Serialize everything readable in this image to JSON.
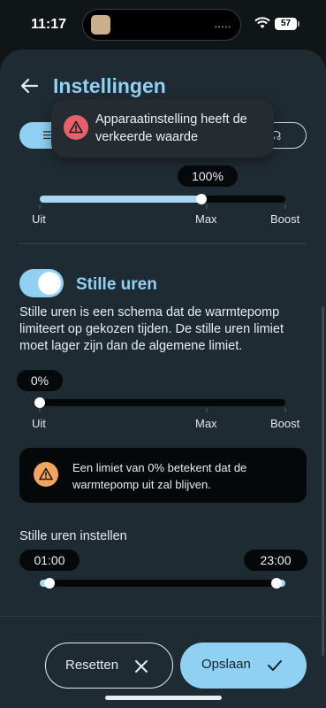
{
  "status_bar": {
    "time": "11:17",
    "battery": "57",
    "island_dots": "•••••"
  },
  "header": {
    "title": "Instellingen"
  },
  "segmented": {
    "left_glyph": "☰",
    "right_glyph": "☊"
  },
  "toast": {
    "message": "Apparaatinstelling heeft de verkeerde waarde"
  },
  "limit_slider": {
    "value_label": "100%",
    "value_fraction": 0.66,
    "labels": {
      "min": "Uit",
      "mid": "Max",
      "max": "Boost"
    }
  },
  "quiet_hours": {
    "enabled": true,
    "title": "Stille uren",
    "description": "Stille uren is een schema dat de warmtepomp limiteert op gekozen tijden. De stille uren limiet moet lager zijn dan de algemene limiet.",
    "slider": {
      "value_label": "0%",
      "value_fraction": 0.0,
      "labels": {
        "min": "Uit",
        "mid": "Max",
        "max": "Boost"
      }
    },
    "info": "Een limiet van 0% betekent dat de warmtepomp uit zal blijven.",
    "schedule_label": "Stille uren instellen",
    "start_time": "01:00",
    "end_time": "23:00"
  },
  "actions": {
    "reset_label": "Resetten",
    "save_label": "Opslaan"
  },
  "colors": {
    "accent": "#8fd0f3",
    "warning": "#e8606c",
    "info": "#f2a560",
    "sheet": "#1f2b32",
    "background": "#101518"
  },
  "icons": {
    "back": "arrow-left-icon",
    "toast": "warning-triangle-icon",
    "info": "warning-triangle-icon",
    "reset": "close-icon",
    "save": "check-icon"
  }
}
